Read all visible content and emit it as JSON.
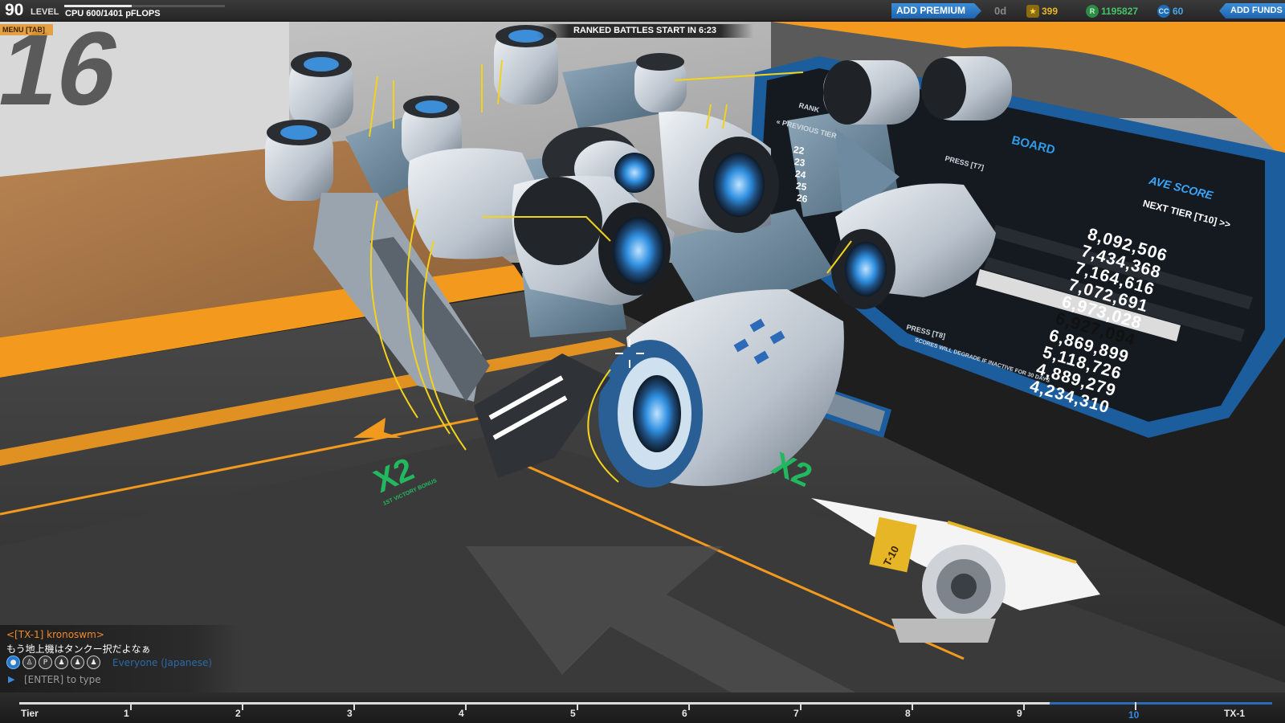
{
  "hud": {
    "level_number": "90",
    "level_label": "LEVEL",
    "xp_progress": 0.42,
    "cpu_text": "CPU 600/1401 pFLOPS",
    "menu_tab": "MENU [TAB]",
    "ranked_banner": "RANKED BATTLES START IN 6:23",
    "premium_button": "ADD PREMIUM",
    "premium_days": "0d",
    "trophies": "399",
    "robits": "1195827",
    "cosmetic_credits": "60",
    "funds_button": "ADD FUNDS",
    "icons": {
      "trophy": "trophy-icon",
      "robits": "robits-coin-icon",
      "cc": "cosmetic-credit-icon"
    },
    "colors": {
      "accent_blue": "#2d7fd0",
      "trophy_gold": "#e6b626",
      "robits_green": "#47c46a",
      "cc_blue": "#49a6ee",
      "floor_orange": "#f39a1e"
    }
  },
  "leaderboard": {
    "title": "BOARD",
    "rank_header": "RANK",
    "previous_tier": "« PREVIOUS TIER",
    "progress_header": "PRESS [T7]",
    "ave_score_header": "AVE SCORE",
    "next_tier": "NEXT TIER [T10] >>",
    "progress_footer": "PRESS [T8]",
    "degrade_note": "SCORES WILL DEGRADE IF INACTIVE FOR 30 DAYS",
    "ranks": [
      "22",
      "23",
      "24",
      "25",
      "26"
    ],
    "scores": [
      "8,092,506",
      "7,434,368",
      "7,164,616",
      "7,072,691",
      "6,973,028",
      "6,927,094",
      "6,869,899",
      "5,118,726",
      "4,889,279",
      "4,234,310"
    ],
    "highlighted_index": 5
  },
  "floor": {
    "bonus_left": "X2",
    "bonus_left_sub": "1ST VICTORY BONUS",
    "bonus_right": "X2",
    "wall_text": "16",
    "robot_tag": "T-10"
  },
  "chat": {
    "sender": "<[TX-1] kronoswm>",
    "message": "もう地上機はタンクー択だよなぁ",
    "channel": "Everyone (Japanese)",
    "placeholder": "[ENTER] to type",
    "icons": [
      "globe-icon",
      "party-icon",
      "private-icon",
      "clan-icon",
      "friends-icon",
      "group-icon"
    ]
  },
  "tier_bar": {
    "labels": [
      "Tier",
      "1",
      "2",
      "3",
      "4",
      "5",
      "6",
      "7",
      "8",
      "9",
      "10",
      "TX-1"
    ],
    "current_tier": "10"
  }
}
